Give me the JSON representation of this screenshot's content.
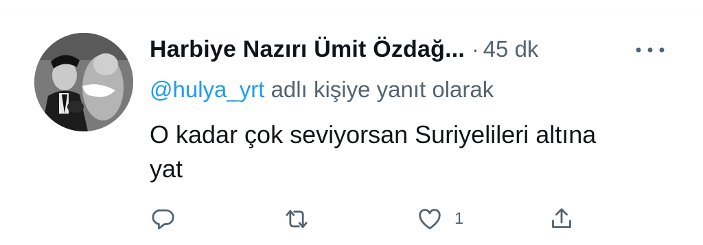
{
  "tweet": {
    "author_name": "Harbiye Nazırı Ümit Özdağ...",
    "separator": "·",
    "timestamp": "45 dk",
    "reply_mention": "@hulya_yrt",
    "reply_suffix": " adlı kişiye yanıt olarak",
    "text_line1": "O kadar çok seviyorsan Suriyelileri altına",
    "text_line2": "yat"
  },
  "actions": {
    "reply_icon": "reply-icon",
    "retweet_icon": "retweet-icon",
    "like_icon": "heart-icon",
    "like_count": "1",
    "share_icon": "share-icon"
  },
  "colors": {
    "text": "#0f1419",
    "secondary": "#536471",
    "link": "#1d9bf0",
    "divider": "#eff3f4"
  }
}
